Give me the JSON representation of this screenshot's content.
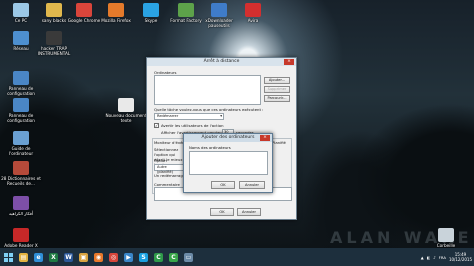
{
  "desktop": {
    "icons": [
      {
        "label": "Ce PC",
        "color": "#9bc8e6"
      },
      {
        "label": "sany blacks",
        "color": "#e0b84d"
      },
      {
        "label": "Google Chrome",
        "color": "#d9453b"
      },
      {
        "label": "Mozilla Firefox",
        "color": "#e47a2b"
      },
      {
        "label": "Skype",
        "color": "#2aa3e4"
      },
      {
        "label": "Format Factory",
        "color": "#5da24a"
      },
      {
        "label": "xDownloader pauseutils",
        "color": "#3f7cc9"
      },
      {
        "label": "Avira",
        "color": "#d32f2f"
      },
      {
        "label": "Réseau",
        "color": "#4d8fcf"
      },
      {
        "label": "hacker TRAP INSTRUMENTAL",
        "color": "#3a3a3a"
      },
      {
        "label": "Panneau de configuration",
        "color": "#4a86c5"
      },
      {
        "label": "Nouveau document texte",
        "color": "#e9e9e9"
      },
      {
        "label": "Panneau de configuration",
        "color": "#4a86c5"
      },
      {
        "label": "Guide de l'ordinateur",
        "color": "#6aa0d2"
      },
      {
        "label": "28 Dictionnaires et Recueils de...",
        "color": "#b54a3a"
      },
      {
        "label": "أفكار الكراهية",
        "color": "#7d4fa8"
      },
      {
        "label": "Adobe Reader X",
        "color": "#c62828"
      },
      {
        "label": "Corbeille",
        "color": "#c9d3da"
      }
    ],
    "watermark": "ALAN WAKE"
  },
  "dialog": {
    "title": "Arrêt à distance",
    "close": "×",
    "computers_label": "Ordinateurs",
    "buttons": {
      "add": "Ajouter...",
      "remove": "Supprimer",
      "browse": "Parcourir..."
    },
    "action_question": "Quelle tâche voulez-vous que ces ordinateurs exécutent :",
    "action_value": "Redémarrer",
    "warn_check_label": "Avertir les utilisateurs de l'action",
    "warn_display_label": "Afficher l'avertissement pendant",
    "warn_seconds": "30",
    "warn_unit": "secondes",
    "shutdown_group_label": "Moniteur d'événements",
    "planned_label": "Planifié",
    "select_reason_label": "Sélectionnez l'option qui décrit le mieux la raison pour laquelle...",
    "option_label": "Option",
    "option_value": "Autre (planifié)",
    "description_label": "Un redémarrage ou un arrêt non planifié...",
    "comment_label": "Commentaire",
    "ok_label": "OK",
    "cancel_label": "Annuler"
  },
  "subdialog": {
    "title": "Ajouter des ordinateurs",
    "close": "×",
    "field_label": "Noms des ordinateurs",
    "ok_label": "OK",
    "cancel_label": "Annuler"
  },
  "taskbar": {
    "apps": [
      {
        "name": "file-explorer",
        "glyph": "▤",
        "color": "#e3b341"
      },
      {
        "name": "internet-explorer",
        "glyph": "e",
        "color": "#2f8fd8"
      },
      {
        "name": "excel",
        "glyph": "X",
        "color": "#1f7a43"
      },
      {
        "name": "word",
        "glyph": "W",
        "color": "#2b5797"
      },
      {
        "name": "windows-explorer",
        "glyph": "▣",
        "color": "#d9a441"
      },
      {
        "name": "firefox",
        "glyph": "◉",
        "color": "#e8782a"
      },
      {
        "name": "chrome",
        "glyph": "◎",
        "color": "#d7463b"
      },
      {
        "name": "media-player",
        "glyph": "▶",
        "color": "#3a86c8"
      },
      {
        "name": "skype",
        "glyph": "S",
        "color": "#1aa0e0"
      },
      {
        "name": "camtasia",
        "glyph": "C",
        "color": "#2e9a4a"
      },
      {
        "name": "green-app",
        "glyph": "C",
        "color": "#3aa54a"
      },
      {
        "name": "remote-shutdown",
        "glyph": "▭",
        "color": "#6b8aa6"
      }
    ],
    "language": "FRA",
    "time": "15:49",
    "date": "10/12/2015"
  }
}
